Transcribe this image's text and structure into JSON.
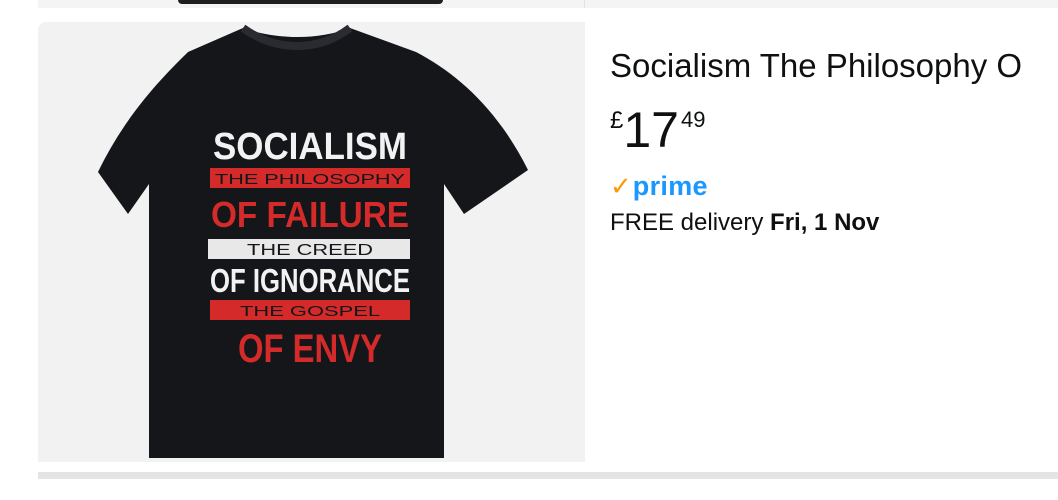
{
  "product": {
    "title": "Socialism The Philosophy O",
    "price": {
      "symbol": "£",
      "whole": "17",
      "fraction": "49"
    },
    "prime": {
      "check": "✓",
      "word": "prime"
    },
    "delivery": {
      "prefix": "FREE delivery ",
      "date": "Fri, 1 Nov"
    },
    "image_text": {
      "line1": "SOCIALISM",
      "line2": "THE PHILOSOPHY",
      "line3": "OF FAILURE",
      "line4": "THE CREED",
      "line5": "OF IGNORANCE",
      "line6": "THE GOSPEL",
      "line7": "OF ENVY"
    }
  },
  "colors": {
    "prime_blue": "#1a98ff",
    "prime_check": "#ff9900",
    "shirt": "#15161a",
    "print_red": "#d42a2a",
    "print_white": "#f2f2f2"
  }
}
